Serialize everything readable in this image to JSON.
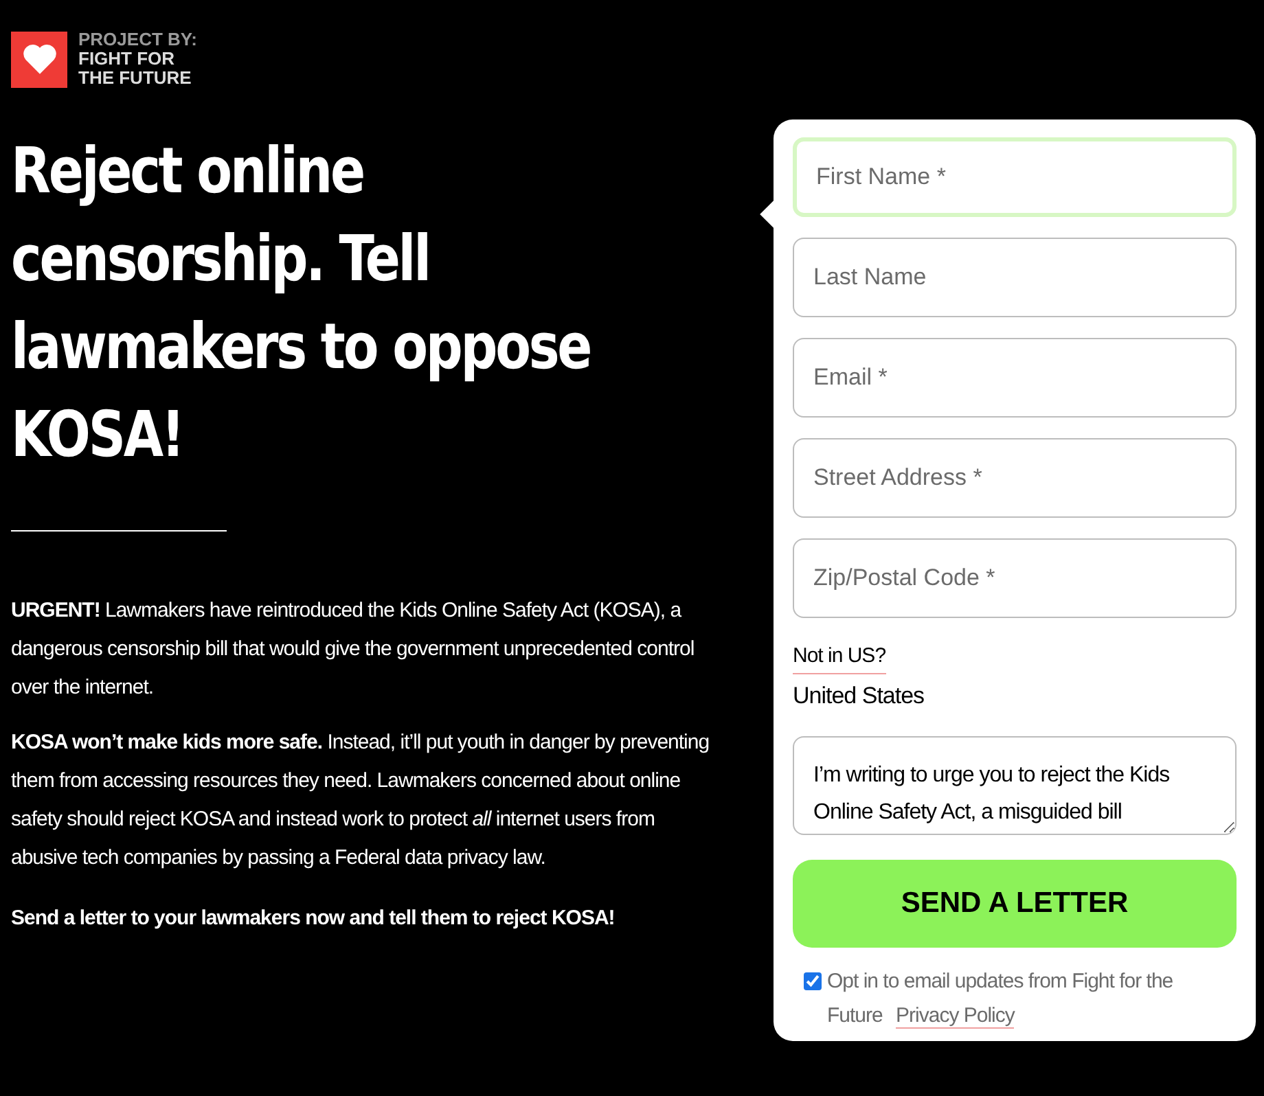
{
  "brand": {
    "eyebrow": "PROJECT BY:",
    "name_lines": [
      "FIGHT FOR",
      "THE FUTURE"
    ]
  },
  "headline": "Reject online censorship. Tell lawmakers to oppose KOSA!",
  "paragraphs": [
    "**URGENT!** Lawmakers have reintroduced the Kids Online Safety Act (KOSA), a dangerous censorship bill that would give the government unprecedented control over the internet.",
    "**KOSA won’t make kids more safe.** Instead, it’ll put youth in danger by preventing them from accessing resources they need. Lawmakers concerned about online safety should reject KOSA and instead work to protect *all* internet users from abusive tech companies by passing a Federal data privacy law."
  ],
  "call_to_action": "Send a letter to your lawmakers now and tell them to reject KOSA!",
  "form": {
    "fields": [
      {
        "placeholder": "First Name *",
        "focused": true
      },
      {
        "placeholder": "Last Name",
        "focused": false
      },
      {
        "placeholder": "Email *",
        "focused": false
      },
      {
        "placeholder": "Street Address *",
        "focused": false
      },
      {
        "placeholder": "Zip/Postal Code *",
        "focused": false
      }
    ],
    "country_link": "Not in US?",
    "country": "United States",
    "letter": "I’m writing to urge you to reject the Kids Online Safety Act, a misguided bill",
    "submit": "SEND A LETTER",
    "opt_in": {
      "checked": true,
      "label": "Opt in to email updates from Fight for the Future",
      "link": "Privacy Policy"
    }
  }
}
